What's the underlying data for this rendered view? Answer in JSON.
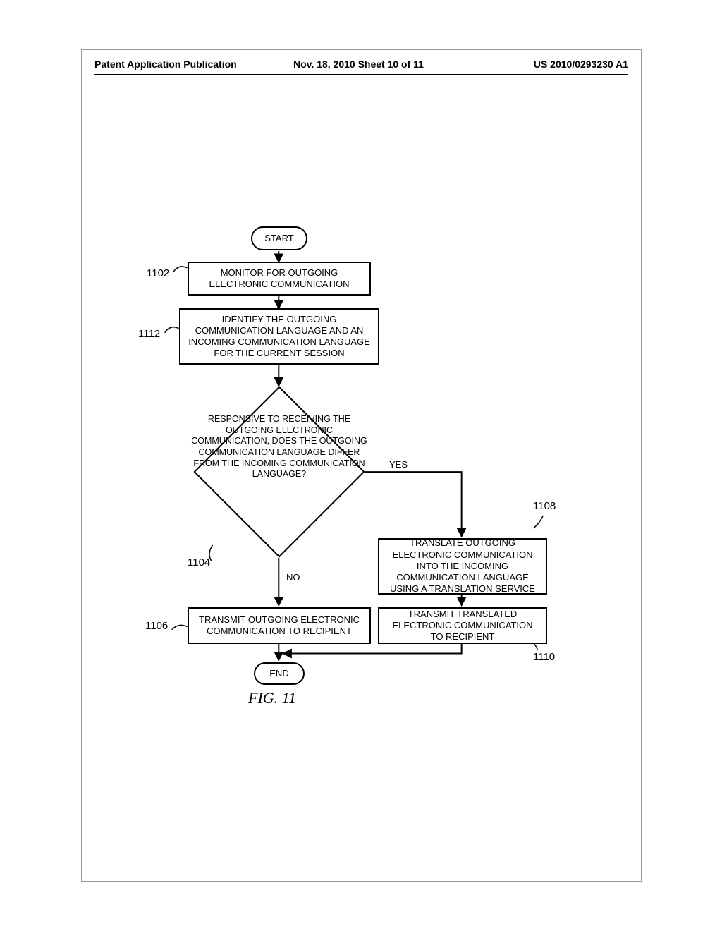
{
  "header": {
    "left": "Patent Application Publication",
    "center": "Nov. 18, 2010  Sheet 10 of 11",
    "right": "US 2010/0293230 A1"
  },
  "flowchart": {
    "start": "START",
    "end": "END",
    "step_1102": "MONITOR FOR OUTGOING ELECTRONIC COMMUNICATION",
    "step_1112": "IDENTIFY THE OUTGOING COMMUNICATION LANGUAGE AND AN INCOMING COMMUNICATION LANGUAGE FOR THE CURRENT SESSION",
    "decision_1104": "RESPONSIVE TO RECEIVING THE OUTGOING ELECTRONIC COMMUNICATION, DOES THE OUTGOING COMMUNICATION LANGUAGE DIFFER FROM THE INCOMING COMMUNICATION LANGUAGE?",
    "step_1108": "TRANSLATE OUTGOING ELECTRONIC COMMUNICATION INTO THE INCOMING COMMUNICATION LANGUAGE USING A TRANSLATION SERVICE",
    "step_1106": "TRANSMIT OUTGOING ELECTRONIC COMMUNICATION TO RECIPIENT",
    "step_1110": "TRANSMIT TRANSLATED ELECTRONIC COMMUNICATION TO RECIPIENT",
    "yes": "YES",
    "no": "NO"
  },
  "refs": {
    "r1102": "1102",
    "r1112": "1112",
    "r1104": "1104",
    "r1106": "1106",
    "r1108": "1108",
    "r1110": "1110"
  },
  "figure_caption": "FIG. 11"
}
